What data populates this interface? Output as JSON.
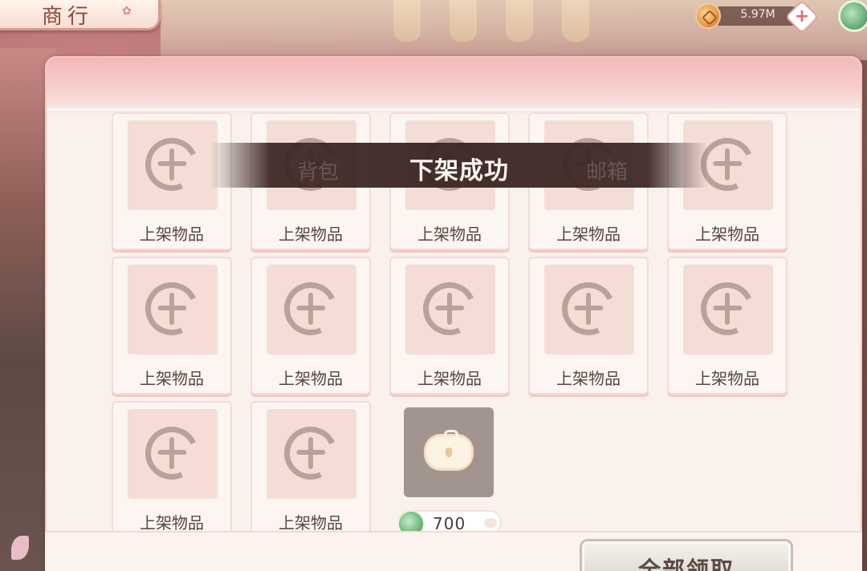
{
  "header": {
    "title": "商行"
  },
  "currency": {
    "amount": "5.97M"
  },
  "toast": {
    "message": "下架成功",
    "ghost_left": "背包",
    "ghost_right": "邮箱"
  },
  "grid": {
    "empty_slot_label": "上架物品",
    "items": [
      {
        "label": "上架物品"
      },
      {
        "label": "上架物品"
      },
      {
        "label": "上架物品"
      },
      {
        "label": "上架物品"
      },
      {
        "label": "上架物品"
      },
      {
        "label": "上架物品"
      },
      {
        "label": "上架物品"
      },
      {
        "label": "上架物品"
      },
      {
        "label": "上架物品"
      },
      {
        "label": "上架物品"
      },
      {
        "label": "上架物品"
      },
      {
        "label": "上架物品"
      }
    ],
    "locked_slot": {
      "price": "700"
    }
  },
  "footer": {
    "claim_all_label": "全部领取"
  },
  "colors": {
    "accent": "#f3b9b8",
    "toast_bg": "#3a2422",
    "label_text": "#5a4640"
  }
}
